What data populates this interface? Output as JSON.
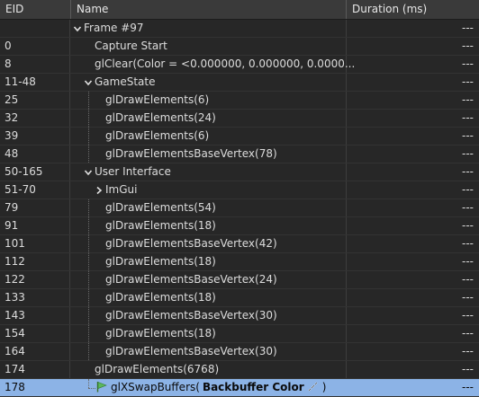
{
  "columns": {
    "eid": "EID",
    "name": "Name",
    "duration": "Duration (ms)"
  },
  "rows": [
    {
      "eid": "",
      "name": "Frame #97",
      "duration": "---"
    },
    {
      "eid": "0",
      "name": "Capture Start",
      "duration": "---"
    },
    {
      "eid": "8",
      "name": "glClear(Color = <0.000000, 0.000000, 0.0000...",
      "duration": "---"
    },
    {
      "eid": "11-48",
      "name": "GameState",
      "duration": "---"
    },
    {
      "eid": "25",
      "name": "glDrawElements(6)",
      "duration": "---"
    },
    {
      "eid": "32",
      "name": "glDrawElements(24)",
      "duration": "---"
    },
    {
      "eid": "39",
      "name": "glDrawElements(6)",
      "duration": "---"
    },
    {
      "eid": "48",
      "name": "glDrawElementsBaseVertex(78)",
      "duration": "---"
    },
    {
      "eid": "50-165",
      "name": "User Interface",
      "duration": "---"
    },
    {
      "eid": "51-70",
      "name": "ImGui",
      "duration": "---"
    },
    {
      "eid": "79",
      "name": "glDrawElements(54)",
      "duration": "---"
    },
    {
      "eid": "91",
      "name": "glDrawElements(18)",
      "duration": "---"
    },
    {
      "eid": "101",
      "name": "glDrawElementsBaseVertex(42)",
      "duration": "---"
    },
    {
      "eid": "112",
      "name": "glDrawElements(18)",
      "duration": "---"
    },
    {
      "eid": "122",
      "name": "glDrawElementsBaseVertex(24)",
      "duration": "---"
    },
    {
      "eid": "133",
      "name": "glDrawElements(18)",
      "duration": "---"
    },
    {
      "eid": "143",
      "name": "glDrawElementsBaseVertex(30)",
      "duration": "---"
    },
    {
      "eid": "154",
      "name": "glDrawElements(18)",
      "duration": "---"
    },
    {
      "eid": "164",
      "name": "glDrawElementsBaseVertex(30)",
      "duration": "---"
    },
    {
      "eid": "174",
      "name": "glDrawElements(6768)",
      "duration": "---"
    },
    {
      "eid": "178",
      "name_prefix": "glXSwapBuffers(",
      "name_bold": "Backbuffer Color",
      "name_suffix": ")",
      "duration": "---",
      "selected": true
    }
  ],
  "icons": {
    "expanded": "chevron-down-icon",
    "collapsed": "chevron-right-icon",
    "bookmark": "green-flag-icon",
    "link": "edit-link-icon"
  },
  "colors": {
    "background": "#272727",
    "header": "#3a3a3a",
    "selection": "#8cb3e6",
    "flag": "#5cb85c"
  }
}
